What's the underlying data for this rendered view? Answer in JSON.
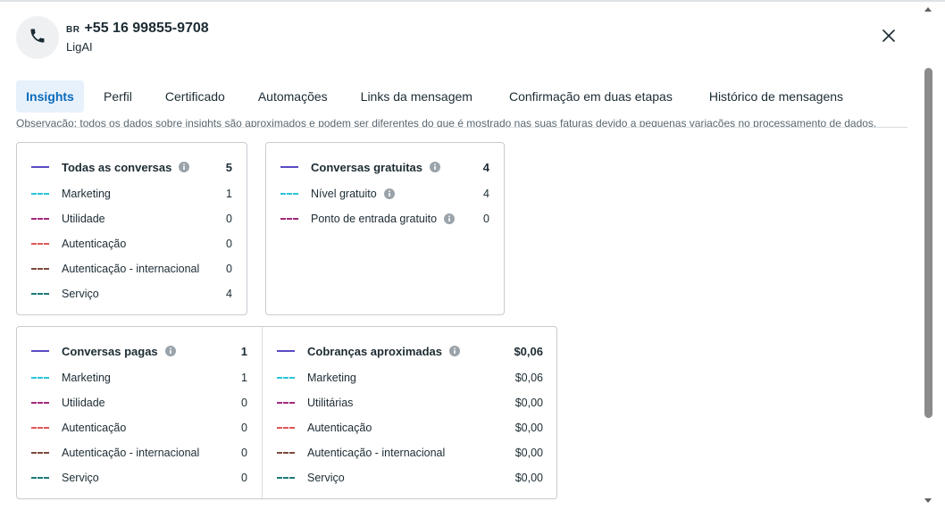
{
  "header": {
    "country_code": "BR",
    "phone": "+55 16 99855-9708",
    "name": "LigAI",
    "avatar_icon": "phone-icon",
    "close_icon": "close-icon"
  },
  "tabs": [
    {
      "label": "Insights",
      "active": true
    },
    {
      "label": "Perfil",
      "active": false
    },
    {
      "label": "Certificado",
      "active": false
    },
    {
      "label": "Automações",
      "active": false
    },
    {
      "label": "Links da mensagem",
      "active": false
    },
    {
      "label": "Confirmação em duas etapas",
      "active": false
    },
    {
      "label": "Histórico de mensagens",
      "active": false
    }
  ],
  "note": "Observação: todos os dados sobre insights são aproximados e podem ser diferentes do que é mostrado nas suas faturas devido a pequenas variações no processamento de dados.",
  "cards": {
    "todas": {
      "title": "Todas as conversas",
      "total": "5",
      "rows": [
        {
          "label": "Marketing",
          "value": "1",
          "color": "#2bc4d6"
        },
        {
          "label": "Utilidade",
          "value": "0",
          "color": "#a3297a"
        },
        {
          "label": "Autenticação",
          "value": "0",
          "color": "#e05656"
        },
        {
          "label": "Autenticação - internacional",
          "value": "0",
          "color": "#7a4a3e"
        },
        {
          "label": "Serviço",
          "value": "4",
          "color": "#1a7a78"
        }
      ]
    },
    "gratuitas": {
      "title": "Conversas gratuitas",
      "total": "4",
      "rows": [
        {
          "label": "Nível gratuito",
          "value": "4",
          "color": "#2bc4d6"
        },
        {
          "label": "Ponto de entrada gratuito",
          "value": "0",
          "color": "#a3297a"
        }
      ]
    },
    "pagas": {
      "title": "Conversas pagas",
      "total": "1",
      "rows": [
        {
          "label": "Marketing",
          "value": "1",
          "color": "#2bc4d6"
        },
        {
          "label": "Utilidade",
          "value": "0",
          "color": "#a3297a"
        },
        {
          "label": "Autenticação",
          "value": "0",
          "color": "#e05656"
        },
        {
          "label": "Autenticação - internacional",
          "value": "0",
          "color": "#7a4a3e"
        },
        {
          "label": "Serviço",
          "value": "0",
          "color": "#1a7a78"
        }
      ]
    },
    "cobrancas": {
      "title": "Cobranças aproximadas",
      "total": "$0,06",
      "rows": [
        {
          "label": "Marketing",
          "value": "$0,06",
          "color": "#2bc4d6"
        },
        {
          "label": "Utilitárias",
          "value": "$0,00",
          "color": "#a3297a"
        },
        {
          "label": "Autenticação",
          "value": "$0,00",
          "color": "#e05656"
        },
        {
          "label": "Autenticação - internacional",
          "value": "$0,00",
          "color": "#7a4a3e"
        },
        {
          "label": "Serviço",
          "value": "$0,00",
          "color": "#1a7a78"
        }
      ]
    }
  },
  "colors": {
    "accent": "#0a6aba",
    "active_tab_bg": "#e7f1fb",
    "total_line": "#5a4bc2"
  }
}
